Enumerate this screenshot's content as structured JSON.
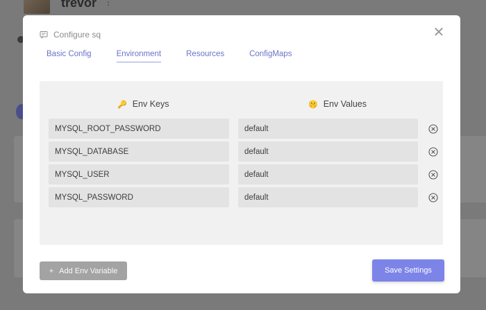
{
  "background": {
    "username": "trevor",
    "dots": "⋮"
  },
  "modal": {
    "title": "Configure sq",
    "title_icon": "comment-icon",
    "close_glyph": "✕",
    "tabs": [
      {
        "label": "Basic Config",
        "active": false
      },
      {
        "label": "Environment",
        "active": true
      },
      {
        "label": "Resources",
        "active": false
      },
      {
        "label": "ConfigMaps",
        "active": false
      }
    ],
    "env": {
      "keys_header": "Env Keys",
      "keys_emoji": "🔑",
      "values_header": "Env Values",
      "values_emoji": "🤫",
      "rows": [
        {
          "key": "MYSQL_ROOT_PASSWORD",
          "value": "default"
        },
        {
          "key": "MYSQL_DATABASE",
          "value": "default"
        },
        {
          "key": "MYSQL_USER",
          "value": "default"
        },
        {
          "key": "MYSQL_PASSWORD",
          "value": "default"
        }
      ]
    },
    "add_button": {
      "plus": "+",
      "label": "Add Env Variable"
    },
    "save_button": "Save Settings"
  },
  "colors": {
    "accent": "#7c84e8",
    "tab_text": "#6b73c7"
  }
}
